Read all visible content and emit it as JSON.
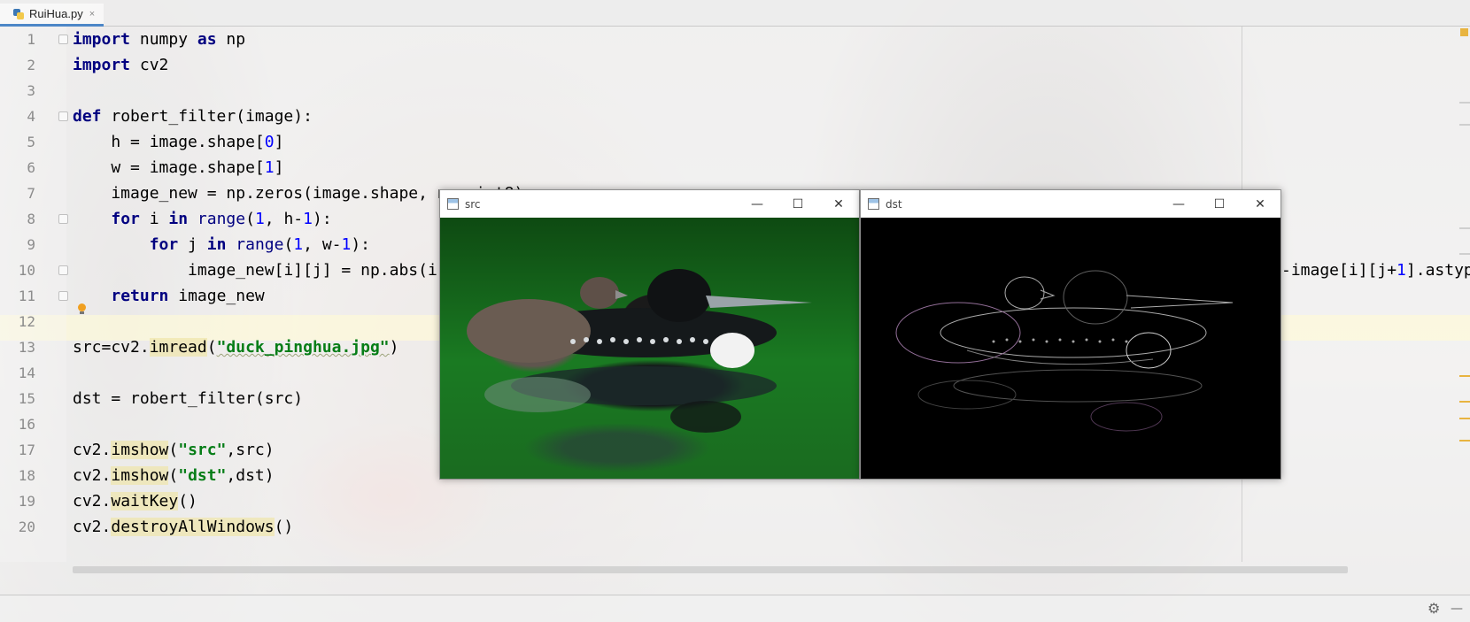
{
  "tab": {
    "filename": "RuiHua.py",
    "close": "×"
  },
  "line_numbers": [
    "1",
    "2",
    "3",
    "4",
    "5",
    "6",
    "7",
    "8",
    "9",
    "10",
    "11",
    "12",
    "13",
    "14",
    "15",
    "16",
    "17",
    "18",
    "19",
    "20"
  ],
  "code": {
    "l1_kw1": "import",
    "l1_rest": " numpy ",
    "l1_kw2": "as",
    "l1_rest2": " np",
    "l2_kw": "import",
    "l2_rest": " cv2",
    "l4_kw": "def",
    "l4_rest": " robert_filter(image):",
    "l5_a": "    h = image.shape[",
    "l5_n": "0",
    "l5_b": "]",
    "l6_a": "    w = image.shape[",
    "l6_n": "1",
    "l6_b": "]",
    "l7": "    image_new = np.zeros(image.shape, np.uint8)",
    "l8_indent": "    ",
    "l8_for": "for",
    "l8_i": " i ",
    "l8_in": "in",
    "l8_sp": " ",
    "l8_range": "range",
    "l8_a": "(",
    "l8_n1": "1",
    "l8_b": ", h-",
    "l8_n2": "1",
    "l8_c": "):",
    "l9_indent": "        ",
    "l9_for": "for",
    "l9_j": " j ",
    "l9_in": "in",
    "l9_sp": " ",
    "l9_range": "range",
    "l9_a": "(",
    "l9_n1": "1",
    "l9_b": ", w-",
    "l9_n2": "1",
    "l9_c": "):",
    "l10": "            image_new[i][j] = np.abs(i",
    "l10_tail_a": "-image[i][j+",
    "l10_tail_n": "1",
    "l10_tail_b": "].astyp",
    "l11_indent": "    ",
    "l11_kw": "return",
    "l11_rest": " image_new",
    "l13_a": "src=cv2.",
    "l13_fn": "imread",
    "l13_b": "(",
    "l13_str": "\"duck_pinghua.jpg\"",
    "l13_c": ")",
    "l15": "dst = robert_filter(src)",
    "l17_a": "cv2.",
    "l17_fn": "imshow",
    "l17_b": "(",
    "l17_str": "\"src\"",
    "l17_c": ",src)",
    "l18_a": "cv2.",
    "l18_fn": "imshow",
    "l18_b": "(",
    "l18_str": "\"dst\"",
    "l18_c": ",dst)",
    "l19_a": "cv2.",
    "l19_fn": "waitKey",
    "l19_b": "()",
    "l20_a": "cv2.",
    "l20_fn": "destroyAllWindows",
    "l20_b": "()"
  },
  "windows": {
    "src": {
      "title": "src",
      "minimize": "—",
      "maximize": "☐",
      "close": "✕"
    },
    "dst": {
      "title": "dst",
      "minimize": "—",
      "maximize": "☐",
      "close": "✕"
    }
  },
  "icons": {
    "settings": "gear-icon",
    "hide": "dash-icon",
    "intention": "lightbulb-icon"
  },
  "colors": {
    "keyword": "#000080",
    "number": "#0000ff",
    "string": "#067d17",
    "current_line": "#fffad7"
  }
}
